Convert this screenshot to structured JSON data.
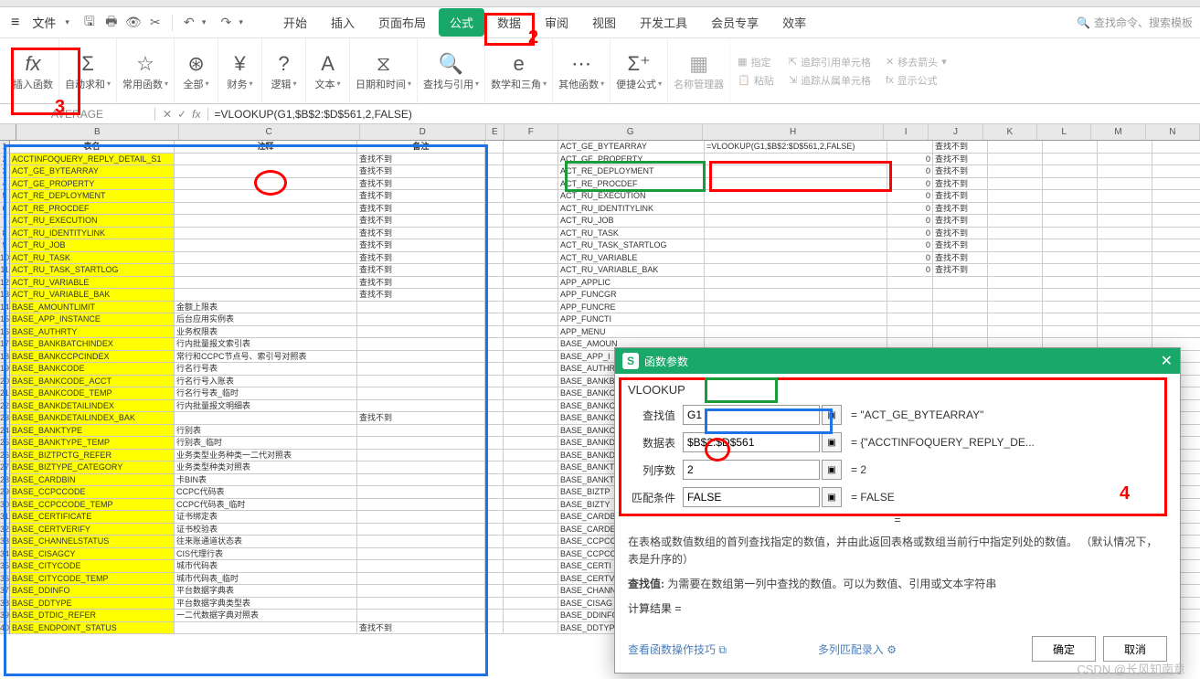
{
  "menu": {
    "file": "文件",
    "tabs": [
      "开始",
      "插入",
      "页面布局",
      "公式",
      "数据",
      "审阅",
      "视图",
      "开发工具",
      "会员专享",
      "效率"
    ],
    "active": 3,
    "search_ph": "查找命令、搜索模板"
  },
  "ribbon": {
    "insert_fn": "插入函数",
    "autosum": "自动求和",
    "common": "常用函数",
    "all": "全部",
    "finance": "财务",
    "logic": "逻辑",
    "text": "文本",
    "datetime": "日期和时间",
    "lookup": "查找与引用",
    "math": "数学和三角",
    "other": "其他函数",
    "shortcut": "便捷公式",
    "name_mgr": "名称管理器",
    "paste": "粘贴",
    "specify": "指定",
    "trace_prec": "追踪引用单元格",
    "move_arrow": "移去箭头",
    "trace_dep": "追踪从属单元格",
    "show_formula": "显示公式"
  },
  "formula_bar": {
    "name": "AVERAGE",
    "formula": "=VLOOKUP(G1,$B$2:$D$561,2,FALSE)"
  },
  "cols": [
    "B",
    "C",
    "D",
    "E",
    "F",
    "G",
    "H",
    "I",
    "J",
    "K",
    "L",
    "M",
    "N"
  ],
  "headers": {
    "B": "表名",
    "C": "注释",
    "D": "备注"
  },
  "not_found": "查找不到",
  "rowsB": [
    "ACCTINFOQUERY_REPLY_DETAIL_S1",
    "ACT_GE_BYTEARRAY",
    "ACT_GE_PROPERTY",
    "ACT_RE_DEPLOYMENT",
    "ACT_RE_PROCDEF",
    "ACT_RU_EXECUTION",
    "ACT_RU_IDENTITYLINK",
    "ACT_RU_JOB",
    "ACT_RU_TASK",
    "ACT_RU_TASK_STARTLOG",
    "ACT_RU_VARIABLE",
    "ACT_RU_VARIABLE_BAK",
    "BASE_AMOUNTLIMIT",
    "BASE_APP_INSTANCE",
    "BASE_AUTHRTY",
    "BASE_BANKBATCHINDEX",
    "BASE_BANKCCPCINDEX",
    "BASE_BANKCODE",
    "BASE_BANKCODE_ACCT",
    "BASE_BANKCODE_TEMP",
    "BASE_BANKDETAILINDEX",
    "BASE_BANKDETAILINDEX_BAK",
    "BASE_BANKTYPE",
    "BASE_BANKTYPE_TEMP",
    "BASE_BIZTPCTG_REFER",
    "BASE_BIZTYPE_CATEGORY",
    "BASE_CARDBIN",
    "BASE_CCPCCODE",
    "BASE_CCPCCODE_TEMP",
    "BASE_CERTIFICATE",
    "BASE_CERTVERIFY",
    "BASE_CHANNELSTATUS",
    "BASE_CISAGCY",
    "BASE_CITYCODE",
    "BASE_CITYCODE_TEMP",
    "BASE_DDINFO",
    "BASE_DDTYPE",
    "BASE_DTDIC_REFER",
    "BASE_ENDPOINT_STATUS"
  ],
  "rowsC": [
    "",
    "",
    "",
    "",
    "",
    "",
    "",
    "",
    "",
    "",
    "",
    "",
    "金额上限表",
    "后台应用实例表",
    "业务权限表",
    "行内批量报文索引表",
    "常行和CCPC节点号、索引号对照表",
    "行名行号表",
    "行名行号入账表",
    "行名行号表_临时",
    "行内批量报文明细表",
    "",
    "行别表",
    "行别表_临时",
    "业务类型业务种类一二代对照表",
    "业务类型种类对照表",
    "卡BIN表",
    "CCPC代码表",
    "CCPC代码表_临时",
    "证书绑定表",
    "证书校验表",
    "往来账通道状态表",
    "CIS代理行表",
    "城市代码表",
    "城市代码表_临时",
    "平台数据字典表",
    "平台数据字典类型表",
    "一二代数据字典对照表",
    ""
  ],
  "rowsD_notfound": [
    0,
    1,
    2,
    3,
    4,
    5,
    6,
    7,
    8,
    9,
    10,
    11,
    21,
    38
  ],
  "rowsG": [
    "ACT_GE_BYTEARRAY",
    "ACT_GE_PROPERTY",
    "ACT_RE_DEPLOYMENT",
    "ACT_RE_PROCDEF",
    "ACT_RU_EXECUTION",
    "ACT_RU_IDENTITYLINK",
    "ACT_RU_JOB",
    "ACT_RU_TASK",
    "ACT_RU_TASK_STARTLOG",
    "ACT_RU_VARIABLE",
    "ACT_RU_VARIABLE_BAK",
    "APP_APPLIC",
    "APP_FUNCGR",
    "APP_FUNCRE",
    "APP_FUNCTI",
    "APP_MENU",
    "BASE_AMOUN",
    "BASE_APP_I",
    "BASE_AUTHR",
    "BASE_BANKB",
    "BASE_BANKC",
    "BASE_BANKC",
    "BASE_BANKC",
    "BASE_BANKC",
    "BASE_BANKD",
    "BASE_BANKD",
    "BASE_BANKT",
    "BASE_BANKT",
    "BASE_BIZTP",
    "BASE_BIZTY",
    "BASE_CARDB",
    "BASE_CARDE",
    "BASE_CCPCC",
    "BASE_CCPCC",
    "BASE_CERTI",
    "BASE_CERTV",
    "BASE_CHANN",
    "BASE_CISAG",
    "BASE_DDINFO",
    "BASE_DDTYP"
  ],
  "H1_formula": "=VLOOKUP(G1,$B$2:$D$561,2,FALSE)",
  "rowsI": [
    0,
    0,
    0,
    0,
    0,
    0,
    0,
    0,
    0,
    0
  ],
  "rowsJ": [
    "查找不到",
    "查找不到",
    "查找不到",
    "查找不到",
    "查找不到",
    "查找不到",
    "查找不到",
    "查找不到",
    "查找不到",
    "查找不到",
    "查找不到"
  ],
  "dialog": {
    "title": "函数参数",
    "func": "VLOOKUP",
    "params": [
      {
        "label": "查找值",
        "val": "G1",
        "res": "= \"ACT_GE_BYTEARRAY\""
      },
      {
        "label": "数据表",
        "val": "$B$2:$D$561",
        "res": "= {\"ACCTINFOQUERY_REPLY_DE..."
      },
      {
        "label": "列序数",
        "val": "2",
        "res": "= 2"
      },
      {
        "label": "匹配条件",
        "val": "FALSE",
        "res": "= FALSE"
      }
    ],
    "eq": "=",
    "desc": "在表格或数值数组的首列查找指定的数值，并由此返回表格或数组当前行中指定列处的数值。 （默认情况下，表是升序的）",
    "sub_label": "查找值:",
    "sub_text": "为需要在数组第一列中查找的数值。可以为数值、引用或文本字符串",
    "calc": "计算结果 =",
    "link1": "查看函数操作技巧",
    "link2": "多列匹配录入",
    "ok": "确定",
    "cancel": "取消"
  },
  "watermark": "CSDN @长风知南意"
}
